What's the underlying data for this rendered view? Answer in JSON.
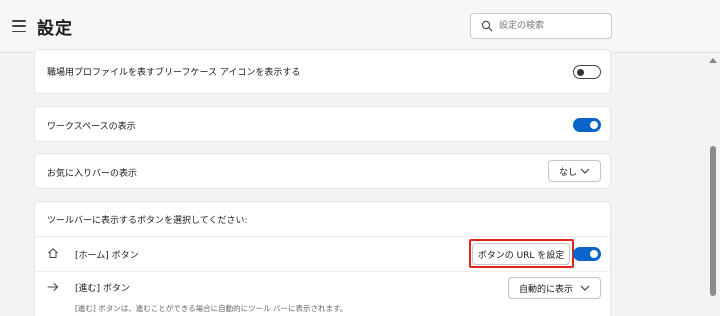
{
  "header": {
    "title": "設定",
    "menu_icon": "hamburger-menu-icon",
    "search": {
      "placeholder": "設定の検索",
      "value": "",
      "icon": "search-icon"
    }
  },
  "settings": {
    "work_profile": {
      "label": "職場用プロファイルを表すブリーフケース アイコンを表示する",
      "enabled": false
    },
    "workspaces": {
      "label": "ワークスペースの表示",
      "enabled": true
    },
    "favorites_bar": {
      "label": "お気に入りバーの表示",
      "selected": "なし"
    },
    "toolbar": {
      "heading": "ツールバーに表示するボタンを選択してください:",
      "home": {
        "icon": "home-icon",
        "label": "[ホーム] ボタン",
        "set_url_label": "ボタンの URL を設定",
        "enabled": true
      },
      "forward": {
        "icon": "arrow-right-icon",
        "label": "[進む] ボタン",
        "description": "[進む] ボタンは、進むことができる場合に自動的にツール バーに表示されます。",
        "selected": "自動的に表示"
      }
    }
  },
  "colors": {
    "accent": "#0a64c9",
    "highlight": "#e0241a"
  }
}
